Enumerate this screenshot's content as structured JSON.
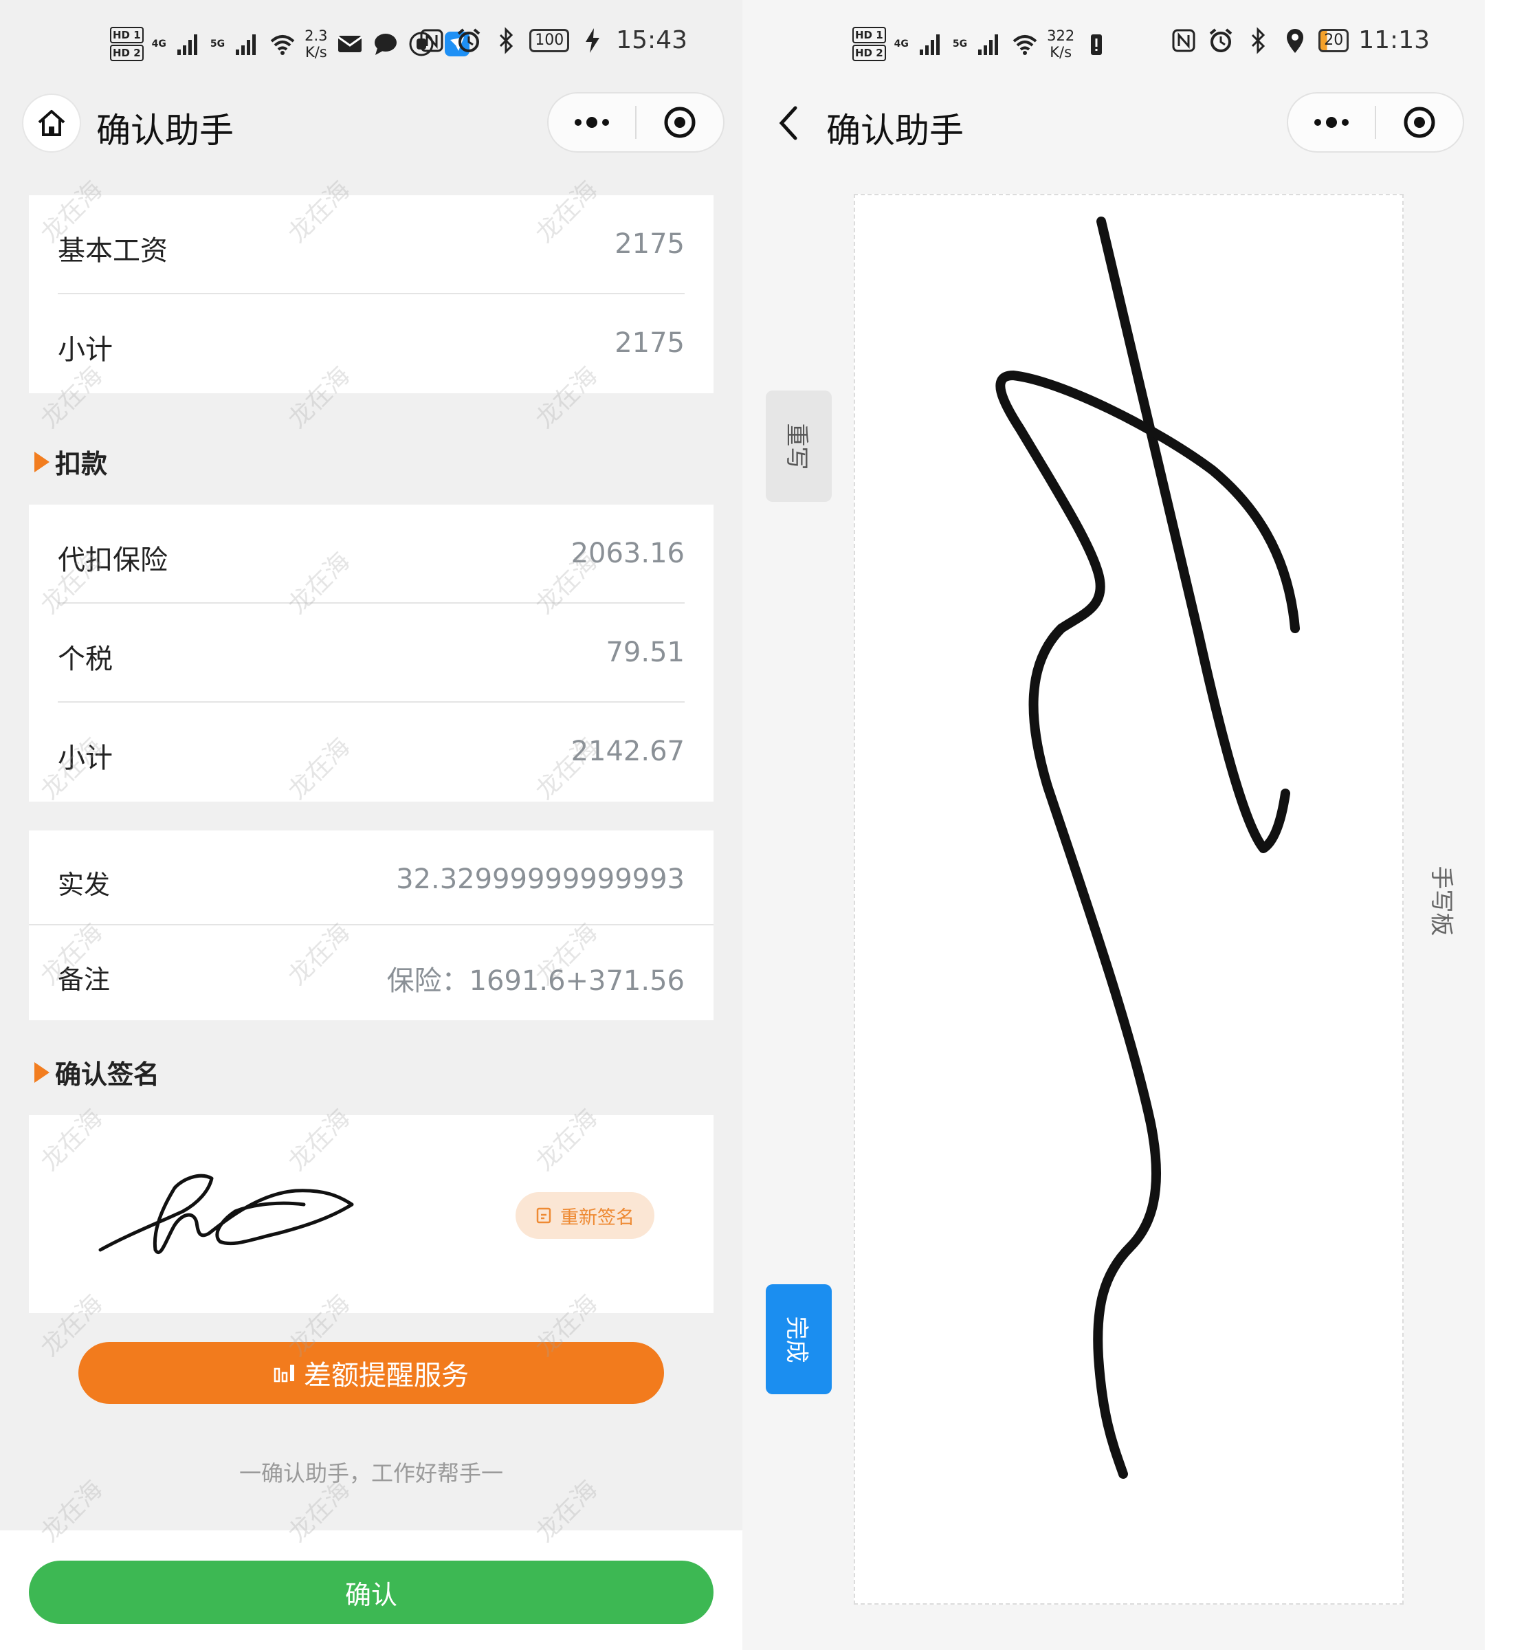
{
  "left": {
    "status": {
      "hd1": "HD 1",
      "hd2": "HD 2",
      "net1": "4G",
      "net2": "5G",
      "speed_value": "2.3",
      "speed_unit": "K/s",
      "battery": "100",
      "time": "15:43"
    },
    "nav": {
      "title": "确认助手"
    },
    "income": [
      {
        "label": "基本工资",
        "value": "2175"
      },
      {
        "label": "小计",
        "value": "2175"
      }
    ],
    "deduction": {
      "title": "扣款",
      "items": [
        {
          "label": "代扣保险",
          "value": "2063.16"
        },
        {
          "label": "个税",
          "value": "79.51"
        },
        {
          "label": "小计",
          "value": "2142.67"
        }
      ]
    },
    "summary": [
      {
        "label": "实发",
        "value": "32.32999999999993"
      },
      {
        "label": "备注",
        "value": "保险：1691.6+371.56"
      }
    ],
    "signature": {
      "title": "确认签名",
      "resign_label": "重新签名"
    },
    "reminder_button": "差额提醒服务",
    "slogan": "一确认助手，工作好帮手一",
    "confirm_button": "确认",
    "watermark": "龙在海"
  },
  "right": {
    "status": {
      "hd1": "HD 1",
      "hd2": "HD 2",
      "net1": "4G",
      "net2": "5G",
      "speed_value": "322",
      "speed_unit": "K/s",
      "battery": "20",
      "time": "11:13"
    },
    "nav": {
      "title": "确认助手"
    },
    "rewrite_button": "重写",
    "done_button": "完成",
    "pad_label": "手写板"
  },
  "colors": {
    "accent_orange": "#f27b1d",
    "confirm_green": "#3db853",
    "done_blue": "#1b8ef0"
  }
}
